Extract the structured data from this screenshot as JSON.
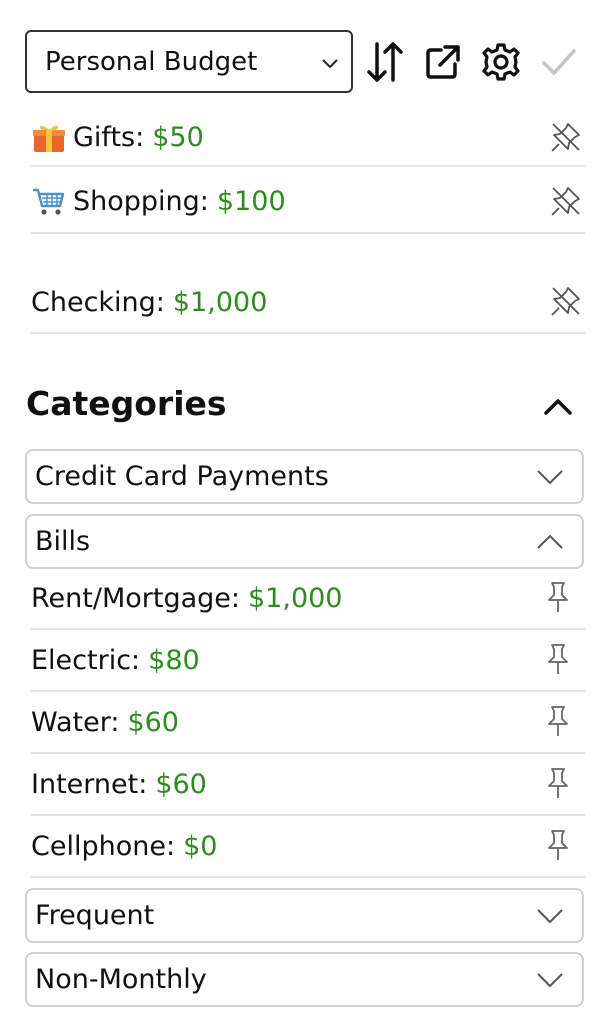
{
  "toolbar": {
    "budget_select_value": "Personal Budget",
    "icons": [
      "sort-icon",
      "external-link-icon",
      "gear-icon",
      "check-icon"
    ]
  },
  "pinned": [
    {
      "emoji": "gift",
      "label": "Gifts:",
      "amount": "$50"
    },
    {
      "emoji": "cart",
      "label": "Shopping:",
      "amount": "$100"
    },
    {
      "label": "Checking:",
      "amount": "$1,000"
    }
  ],
  "categories": {
    "title": "Categories",
    "groups": [
      {
        "name": "Credit Card Payments",
        "expanded": false
      },
      {
        "name": "Bills",
        "expanded": true,
        "items": [
          {
            "label": "Rent/Mortgage:",
            "amount": "$1,000"
          },
          {
            "label": "Electric:",
            "amount": "$80"
          },
          {
            "label": "Water:",
            "amount": "$60"
          },
          {
            "label": "Internet:",
            "amount": "$60"
          },
          {
            "label": "Cellphone:",
            "amount": "$0"
          }
        ]
      },
      {
        "name": "Frequent",
        "expanded": false
      },
      {
        "name": "Non-Monthly",
        "expanded": false
      }
    ]
  },
  "colors": {
    "amount": "#2e8b1f",
    "border": "#cfcfcf",
    "divider": "#e2e2e2"
  }
}
